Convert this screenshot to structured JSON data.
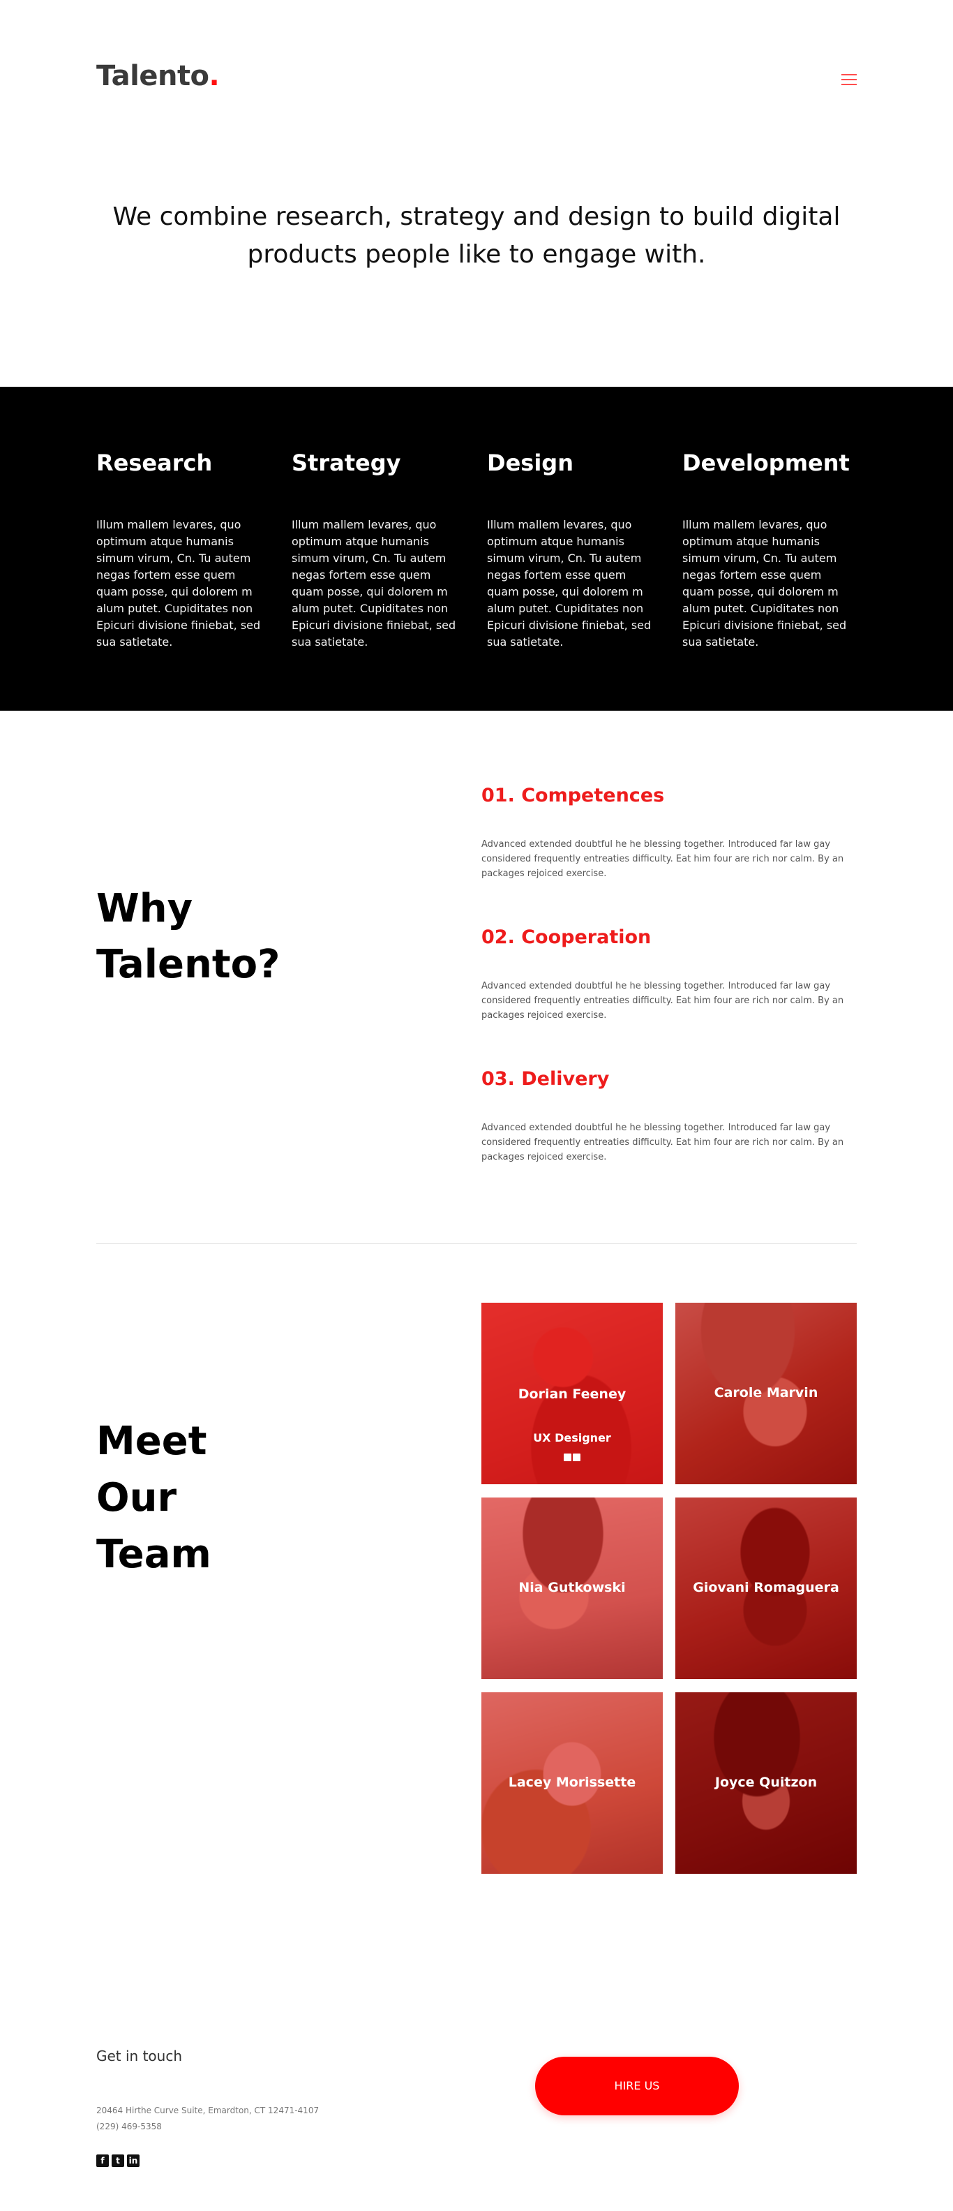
{
  "brand": {
    "name": "Talento",
    "dot": ".",
    "accent": "#ff1010"
  },
  "header": {
    "menu_icon": "hamburger-icon"
  },
  "intro": {
    "line1": "We combine research, strategy and design to build digital",
    "line2": "products people like to engage with."
  },
  "services": [
    {
      "title": "Research",
      "text": "Illum mallem levares, quo optimum atque humanis simum virum, Cn. Tu autem negas fortem esse quem quam posse, qui dolorem m alum putet. Cupiditates non Epicuri divisione finiebat, sed sua satietate."
    },
    {
      "title": "Strategy",
      "text": "Illum mallem levares, quo optimum atque humanis simum virum, Cn. Tu autem negas fortem esse quem quam posse, qui dolorem m alum putet. Cupiditates non Epicuri divisione finiebat, sed sua satietate."
    },
    {
      "title": "Design",
      "text": "Illum mallem levares, quo optimum atque humanis simum virum, Cn. Tu autem negas fortem esse quem quam posse, qui dolorem m alum putet. Cupiditates non Epicuri divisione finiebat, sed sua satietate."
    },
    {
      "title": "Development",
      "text": "Illum mallem levares, quo optimum atque humanis simum virum, Cn. Tu autem negas fortem esse quem quam posse, qui dolorem m alum putet. Cupiditates non Epicuri divisione finiebat, sed sua satietate."
    }
  ],
  "why": {
    "title_line1": "Why",
    "title_line2": "Talento?",
    "items": [
      {
        "heading": "01. Competences",
        "text": "Advanced extended doubtful he he blessing together. Introduced far law gay considered frequently entreaties difficulty. Eat him four are rich nor calm. By an packages rejoiced exercise."
      },
      {
        "heading": "02. Cooperation",
        "text": "Advanced extended doubtful he he blessing together. Introduced far law gay considered frequently entreaties difficulty. Eat him four are rich nor calm. By an packages rejoiced exercise."
      },
      {
        "heading": "03. Delivery",
        "text": "Advanced extended doubtful he he blessing together. Introduced far law gay considered frequently entreaties difficulty. Eat him four are rich nor calm. By an packages rejoiced exercise."
      }
    ]
  },
  "team": {
    "title_line1": "Meet",
    "title_line2": "Our",
    "title_line3": "Team",
    "members": [
      {
        "name": "Dorian Feeney",
        "role": "UX Designer",
        "socials": [
          "linkedin-icon",
          "twitter-icon"
        ]
      },
      {
        "name": "Carole Marvin"
      },
      {
        "name": "Nia Gutkowski"
      },
      {
        "name": "Giovani Romaguera"
      },
      {
        "name": "Lacey Morissette"
      },
      {
        "name": "Joyce Quitzon"
      }
    ]
  },
  "footer": {
    "get_in_touch": "Get in touch",
    "address": "20464 Hirthe Curve Suite, Emardton, CT 12471-4107",
    "phone": "(229) 469-5358",
    "socials": [
      "facebook-icon",
      "twitter-icon",
      "linkedin-icon"
    ],
    "hire_label": "HIRE US"
  }
}
